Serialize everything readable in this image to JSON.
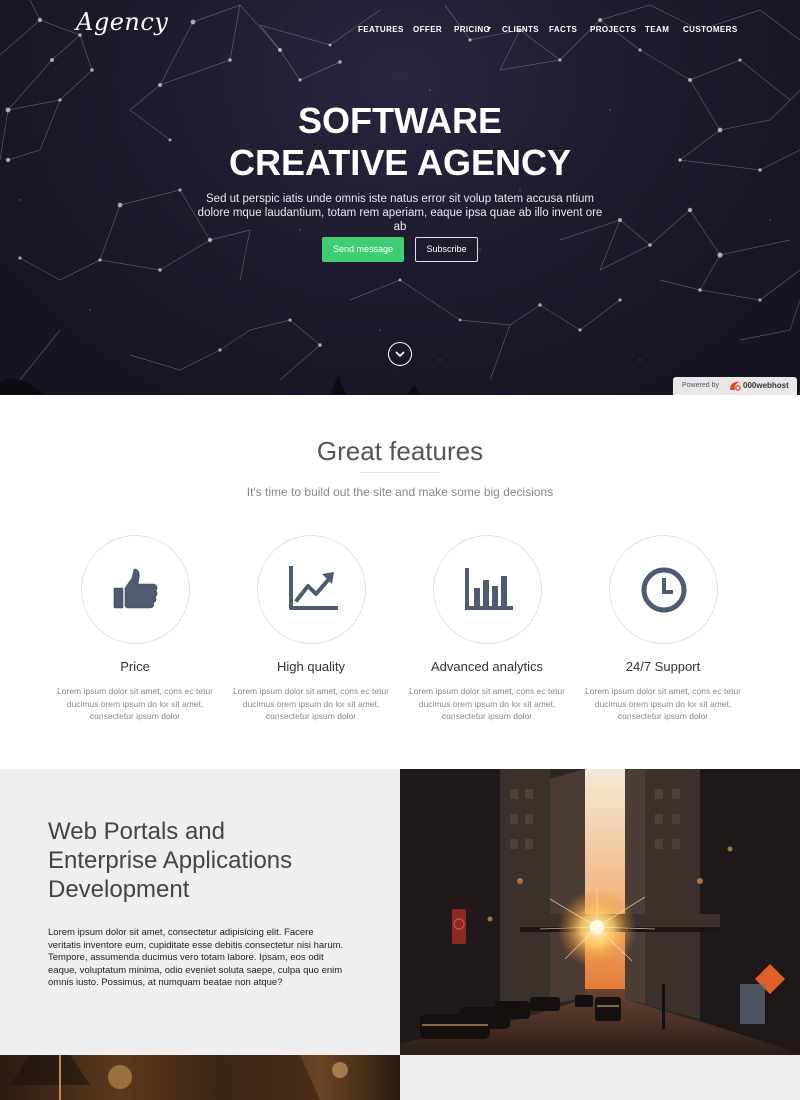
{
  "header": {
    "logo": "Agency",
    "nav": [
      {
        "label": "FEATURES"
      },
      {
        "label": "OFFER"
      },
      {
        "label": "PRICING"
      },
      {
        "label": "CLIENTS"
      },
      {
        "label": "FACTS"
      },
      {
        "label": "PROJECTS"
      },
      {
        "label": "TEAM"
      },
      {
        "label": "CUSTOMERS"
      }
    ]
  },
  "hero": {
    "title_line1": "SOFTWARE",
    "title_line2": "CREATIVE AGENCY",
    "subtitle": "Sed ut perspic iatis unde omnis iste natus error sit volup tatem accusa ntium dolore mque laudantium, totam rem aperiam, eaque ipsa quae ab illo invent ore ab",
    "send_label": "Send message",
    "subscribe_label": "Subscribe",
    "accent_green": "#3fcd72",
    "scroll_icon": "chevron-down-icon"
  },
  "powered_by": {
    "label": "Powered by",
    "brand": "000webhost"
  },
  "features": {
    "title": "Great features",
    "subtitle": "It's time to build out the site and make some big decisions",
    "items": [
      {
        "icon": "thumbs-up-icon",
        "title": "Price",
        "text": "Lorem ipsum dolor sit amet, cons ec tetur ducimus orem ipsum do lor sit amet, consectetur ipsum dolor"
      },
      {
        "icon": "line-chart-icon",
        "title": "High quality",
        "text": "Lorem ipsum dolor sit amet, cons ec tetur ducimus orem ipsum do lor sit amet, consectetur ipsum dolor"
      },
      {
        "icon": "bar-chart-icon",
        "title": "Advanced analytics",
        "text": "Lorem ipsum dolor sit amet, cons ec tetur ducimus orem ipsum do lor sit amet, consectetur ipsum dolor"
      },
      {
        "icon": "clock-icon",
        "title": "24/7 Support",
        "text": "Lorem ipsum dolor sit amet, cons ec tetur ducimus orem ipsum do lor sit amet, consectetur ipsum dolor"
      }
    ],
    "icon_color": "#4f5b6e"
  },
  "portal": {
    "title_line1": "Web Portals and",
    "title_line2": "Enterprise Applications",
    "title_line3": "Development",
    "text": "Lorem ipsum dolor sit amet, consectetur adipisicing elit. Facere veritatis inventore eum, cupiditate esse debitis consectetur nisi harum. Tempore, assumenda ducimus vero totam labore. Ipsam, eos odit eaque, voluptatum minima, odio eveniet soluta saepe, culpa quo enim omnis iusto. Possimus, at numquam beatae non atque?"
  }
}
